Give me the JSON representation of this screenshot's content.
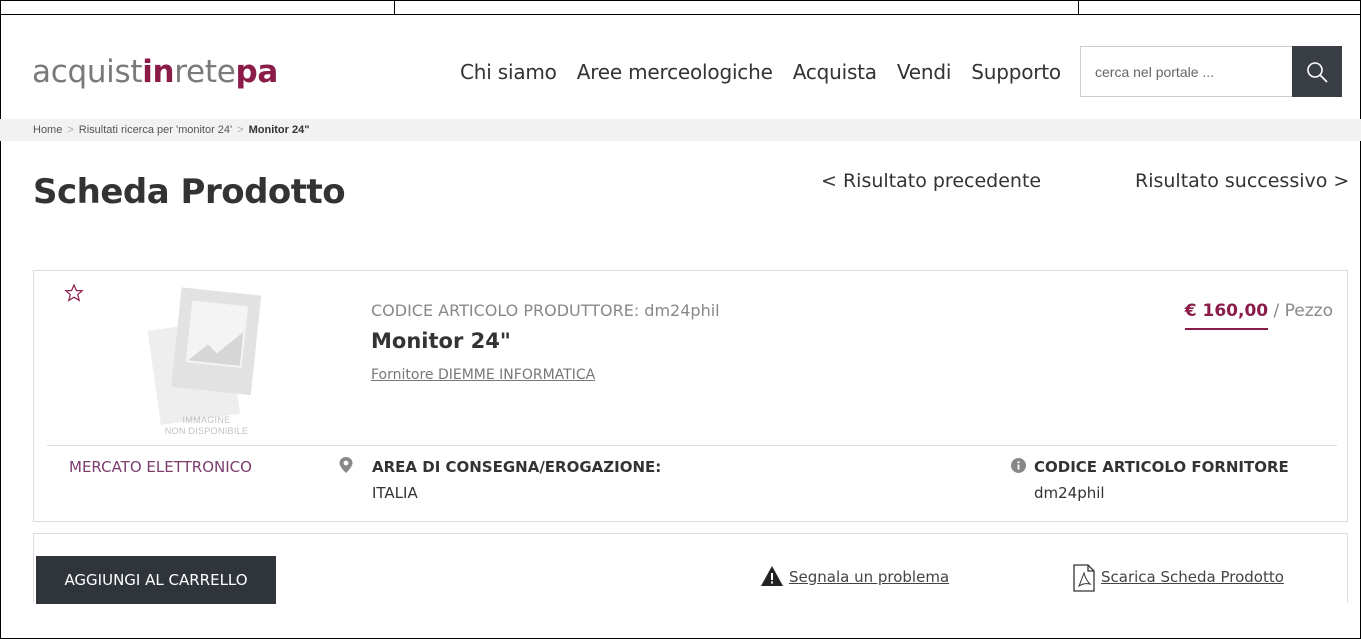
{
  "logo": {
    "part1": "acquist",
    "part2": "in",
    "part3": "rete",
    "part4": "pa"
  },
  "nav": {
    "items": [
      {
        "label": "Chi siamo"
      },
      {
        "label": "Aree merceologiche"
      },
      {
        "label": "Acquista"
      },
      {
        "label": "Vendi"
      },
      {
        "label": "Supporto"
      }
    ]
  },
  "search": {
    "placeholder": "cerca nel portale ..."
  },
  "breadcrumb": {
    "home": "Home",
    "results": "Risultati ricerca per 'monitor 24'",
    "current": "Monitor 24\"",
    "separator": ">"
  },
  "page": {
    "title": "Scheda Prodotto",
    "prev": "< Risultato precedente",
    "next": "Risultato successivo >"
  },
  "product": {
    "image_placeholder_line1": "IMMAGINE",
    "image_placeholder_line2": "NON DISPONIBILE",
    "codice_produttore": "CODICE ARTICOLO PRODUTTORE: dm24phil",
    "name": "Monitor 24\"",
    "fornitore": "Fornitore DIEMME INFORMATICA",
    "price": "€ 160,00",
    "price_unit": " / Pezzo",
    "mercato": "MERCATO ELETTRONICO",
    "area_label": "AREA DI CONSEGNA/EROGAZIONE:",
    "area_value": "ITALIA",
    "codice_fornitore_label": "CODICE ARTICOLO FORNITORE",
    "codice_fornitore_value": "dm24phil"
  },
  "actions": {
    "add_to_cart": "AGGIUNGI AL CARRELLO",
    "report": "Segnala un problema",
    "download": "Scarica Scheda Prodotto"
  },
  "colors": {
    "brand": "#8b1c4a",
    "dark_button": "#2f353b",
    "mercato": "#7b3c6e"
  }
}
